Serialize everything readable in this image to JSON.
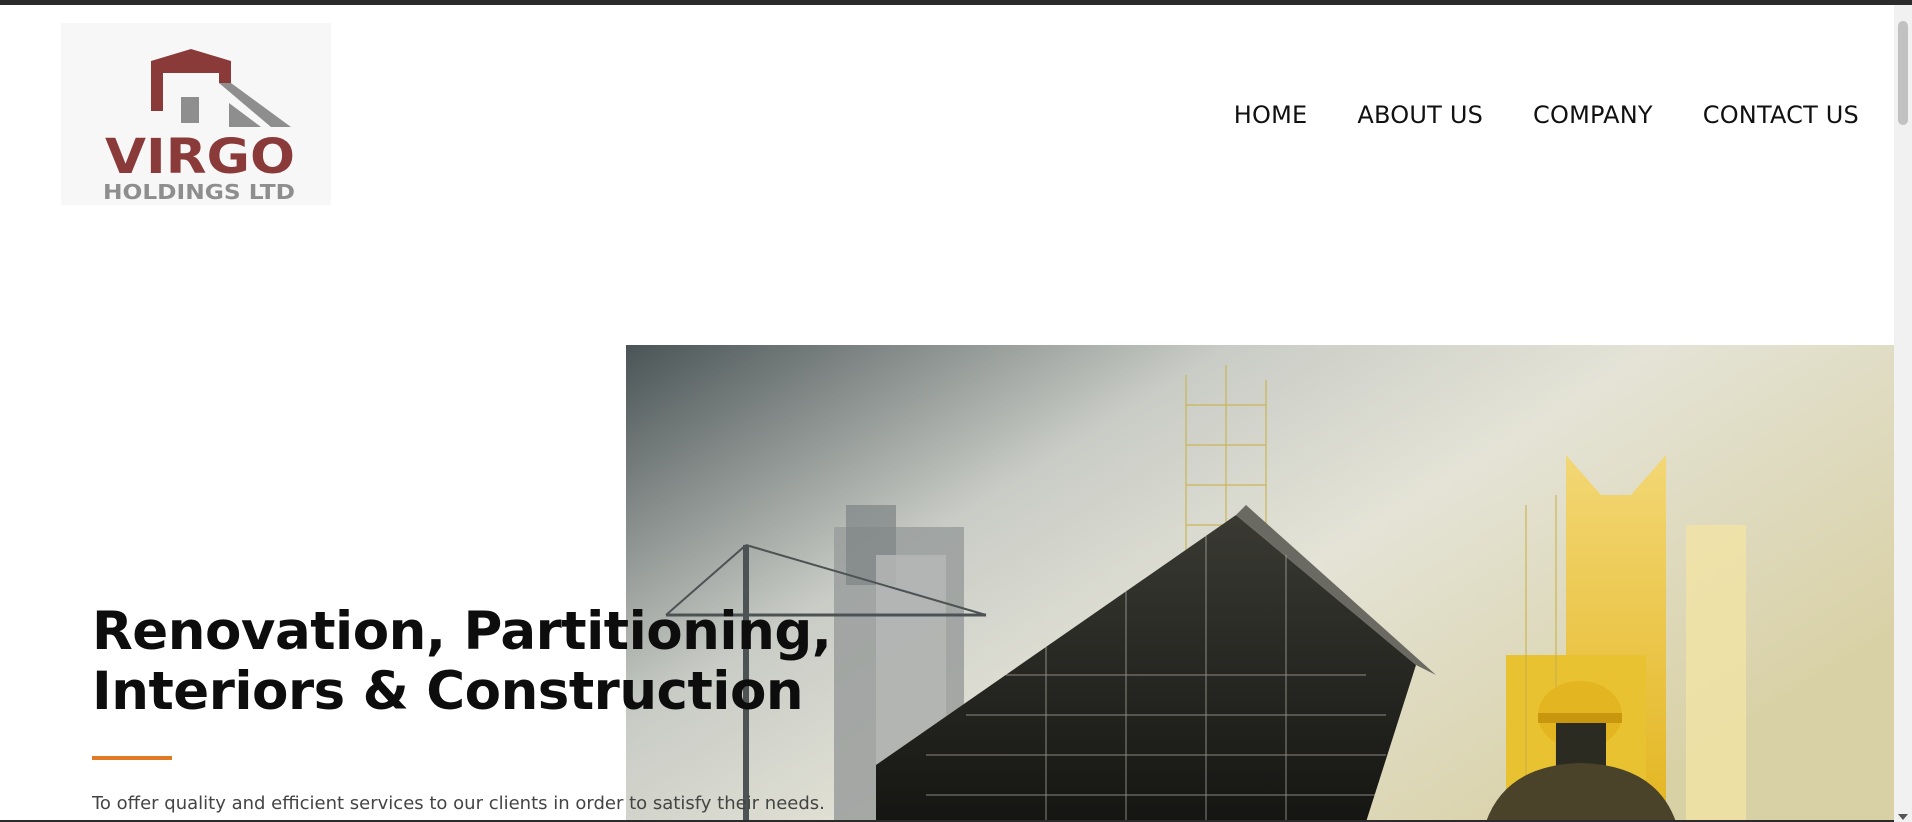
{
  "header": {
    "logo": {
      "line1": "VIRGO",
      "line2": "HOLDINGS LTD",
      "colors": {
        "roof": "#8b3a3a",
        "gray": "#8e8e8e"
      }
    },
    "nav": [
      {
        "label": "HOME"
      },
      {
        "label": "ABOUT US"
      },
      {
        "label": "COMPANY"
      },
      {
        "label": "CONTACT US"
      }
    ]
  },
  "hero": {
    "title_line1": "Renovation, Partitioning,",
    "title_line2": "Interiors & Construction",
    "subtitle": "To offer quality and efficient services to our clients in order to satisfy their needs.",
    "accent_color": "#e07a25"
  }
}
